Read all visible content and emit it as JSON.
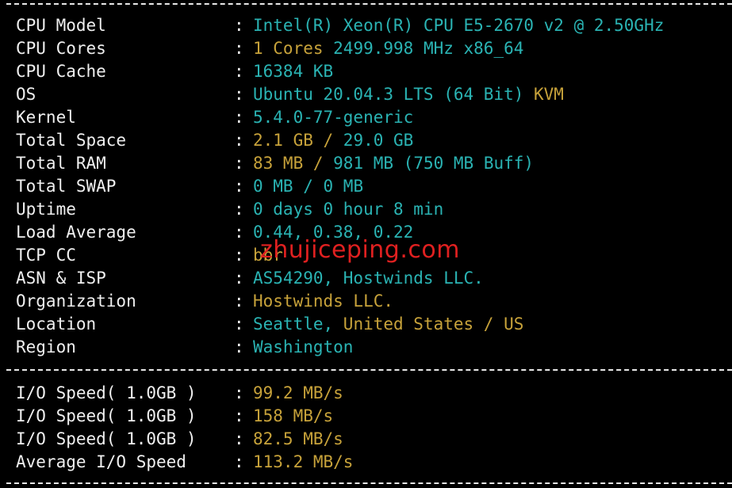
{
  "info": [
    {
      "label": "CPU Model",
      "value": [
        {
          "t": "Intel(R) Xeon(R) CPU E5-2670 v2 @ 2.50GHz",
          "c": "cyan"
        }
      ]
    },
    {
      "label": "CPU Cores",
      "value": [
        {
          "t": "1 Cores ",
          "c": "yellow"
        },
        {
          "t": "2499.998 MHz x86_64",
          "c": "cyan"
        }
      ]
    },
    {
      "label": "CPU Cache",
      "value": [
        {
          "t": "16384 KB",
          "c": "cyan"
        }
      ]
    },
    {
      "label": "OS",
      "value": [
        {
          "t": "Ubuntu 20.04.3 LTS (64 Bit) ",
          "c": "cyan"
        },
        {
          "t": "KVM",
          "c": "yellow"
        }
      ]
    },
    {
      "label": "Kernel",
      "value": [
        {
          "t": "5.4.0-77-generic",
          "c": "cyan"
        }
      ]
    },
    {
      "label": "Total Space",
      "value": [
        {
          "t": "2.1 GB / ",
          "c": "yellow"
        },
        {
          "t": "29.0 GB",
          "c": "cyan"
        }
      ]
    },
    {
      "label": "Total RAM",
      "value": [
        {
          "t": "83 MB / ",
          "c": "yellow"
        },
        {
          "t": "981 MB ",
          "c": "cyan"
        },
        {
          "t": "(750 MB Buff)",
          "c": "cyan"
        }
      ]
    },
    {
      "label": "Total SWAP",
      "value": [
        {
          "t": "0 MB / ",
          "c": "cyan"
        },
        {
          "t": "0 MB",
          "c": "cyan"
        }
      ]
    },
    {
      "label": "Uptime",
      "value": [
        {
          "t": "0 days 0 hour 8 min",
          "c": "cyan"
        }
      ]
    },
    {
      "label": "Load Average",
      "value": [
        {
          "t": "0.44, 0.38, 0.22",
          "c": "cyan"
        }
      ]
    },
    {
      "label": "TCP CC",
      "value": [
        {
          "t": "bbr",
          "c": "yellow"
        }
      ]
    },
    {
      "label": "ASN & ISP",
      "value": [
        {
          "t": "AS54290, Hostwinds LLC.",
          "c": "cyan"
        }
      ]
    },
    {
      "label": "Organization",
      "value": [
        {
          "t": "Hostwinds LLC.",
          "c": "yellow"
        }
      ]
    },
    {
      "label": "Location",
      "value": [
        {
          "t": "Seattle, ",
          "c": "cyan"
        },
        {
          "t": "United States / US",
          "c": "yellow"
        }
      ]
    },
    {
      "label": "Region",
      "value": [
        {
          "t": "Washington",
          "c": "cyan"
        }
      ]
    }
  ],
  "io": [
    {
      "label": "I/O Speed( 1.0GB )",
      "value": [
        {
          "t": "99.2 MB/s",
          "c": "yellow"
        }
      ]
    },
    {
      "label": "I/O Speed( 1.0GB )",
      "value": [
        {
          "t": "158 MB/s",
          "c": "yellow"
        }
      ]
    },
    {
      "label": "I/O Speed( 1.0GB )",
      "value": [
        {
          "t": "82.5 MB/s",
          "c": "yellow"
        }
      ]
    },
    {
      "label": "Average I/O Speed",
      "value": [
        {
          "t": "113.2 MB/s",
          "c": "yellow"
        }
      ]
    }
  ],
  "colon": ":",
  "watermark": "zhujiceping.com",
  "colors": {
    "cyan": "#2ab3b3",
    "yellow": "#c7a23a",
    "white": "#f0f0f0",
    "watermark": "#e02020",
    "background": "#000000"
  }
}
